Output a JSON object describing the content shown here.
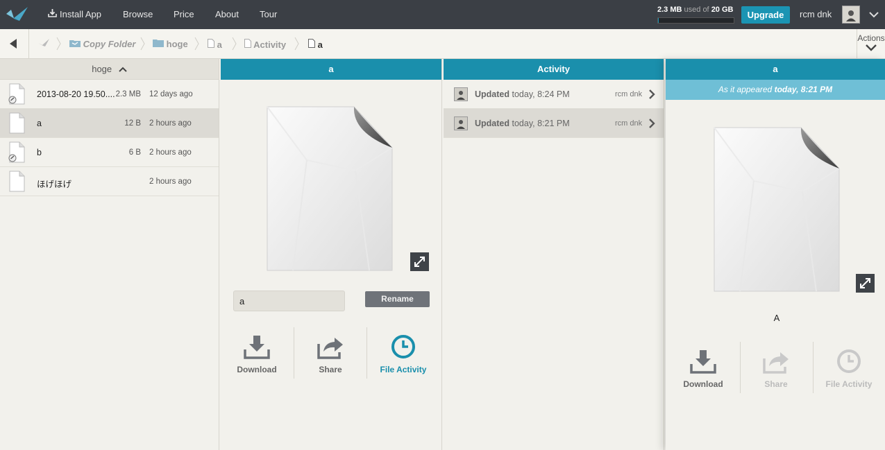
{
  "topbar": {
    "nav": [
      {
        "label": "Install App",
        "icon": "download-tray-icon"
      },
      {
        "label": "Browse"
      },
      {
        "label": "Price"
      },
      {
        "label": "About"
      },
      {
        "label": "Tour"
      }
    ],
    "storage": {
      "used": "2.3 MB",
      "used_of": "used of",
      "total": "20 GB",
      "fraction": 0.0115
    },
    "upgrade_label": "Upgrade",
    "username": "rcm dnk",
    "accent": "#1b94b3"
  },
  "breadcrumb": {
    "items": [
      {
        "label": "Copy Folder",
        "icon": "app-folder-icon"
      },
      {
        "label": "hoge",
        "icon": "folder-icon"
      },
      {
        "label": "a",
        "icon": "file-icon"
      },
      {
        "label": "Activity",
        "icon": "file-icon"
      },
      {
        "label": "a",
        "icon": "file-icon"
      }
    ],
    "actions_label": "Actions"
  },
  "folder_list": {
    "title": "hoge",
    "files": [
      {
        "name": "2013-08-20 19.50....",
        "size": "2.3 MB",
        "modified": "12 days ago",
        "shared": true
      },
      {
        "name": "a",
        "size": "12 B",
        "modified": "2 hours ago",
        "shared": false,
        "selected": true
      },
      {
        "name": "b",
        "size": "6 B",
        "modified": "2 hours ago",
        "shared": true
      },
      {
        "name": "ほげほげ",
        "size": "",
        "modified": "2 hours ago",
        "shared": false
      }
    ]
  },
  "file_panel": {
    "title": "a",
    "rename_value": "a",
    "rename_label": "Rename",
    "actions": [
      {
        "label": "Download",
        "icon": "download-icon"
      },
      {
        "label": "Share",
        "icon": "share-icon"
      },
      {
        "label": "File Activity",
        "icon": "clock-icon",
        "active": true
      }
    ]
  },
  "activity_panel": {
    "title": "Activity",
    "entries": [
      {
        "action": "Updated",
        "time": "today, 8:24 PM",
        "user": "rcm dnk"
      },
      {
        "action": "Updated",
        "time": "today, 8:21 PM",
        "user": "rcm dnk",
        "selected": true
      }
    ]
  },
  "version_panel": {
    "title": "a",
    "appeared_prefix": "As it appeared",
    "appeared_time": "today, 8:21 PM",
    "caption": "A",
    "actions": [
      {
        "label": "Download",
        "icon": "download-icon"
      },
      {
        "label": "Share",
        "icon": "share-icon",
        "disabled": true
      },
      {
        "label": "File Activity",
        "icon": "clock-icon",
        "disabled": true
      }
    ]
  }
}
